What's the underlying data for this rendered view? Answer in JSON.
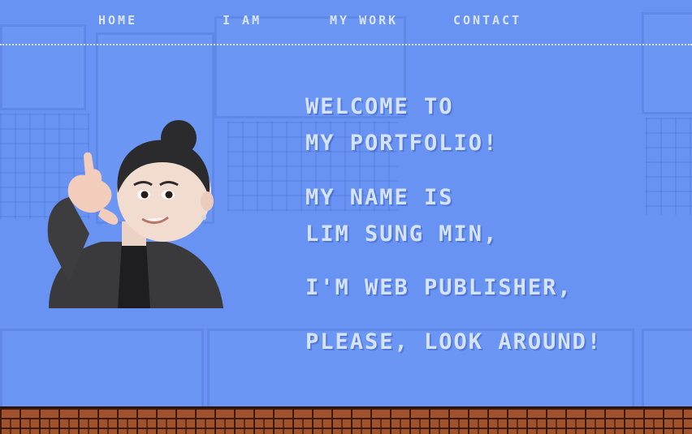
{
  "nav": {
    "items": [
      {
        "label": "HOME"
      },
      {
        "label": "I AM"
      },
      {
        "label": "MY WORK"
      },
      {
        "label": "CONTACT"
      }
    ]
  },
  "hero": {
    "line1": "WELCOME TO",
    "line2": "MY PORTFOLIO!",
    "line3": "MY NAME IS",
    "line4": "LIM SUNG MIN,",
    "line5": "I'M WEB PUBLISHER,",
    "line6": "PLEASE, LOOK AROUND!"
  },
  "colors": {
    "background": "#6893f3",
    "text": "#d6e3ff",
    "brick": "#a0522d"
  },
  "icons": {
    "avatar": "memoji-avatar-call-me-gesture"
  }
}
